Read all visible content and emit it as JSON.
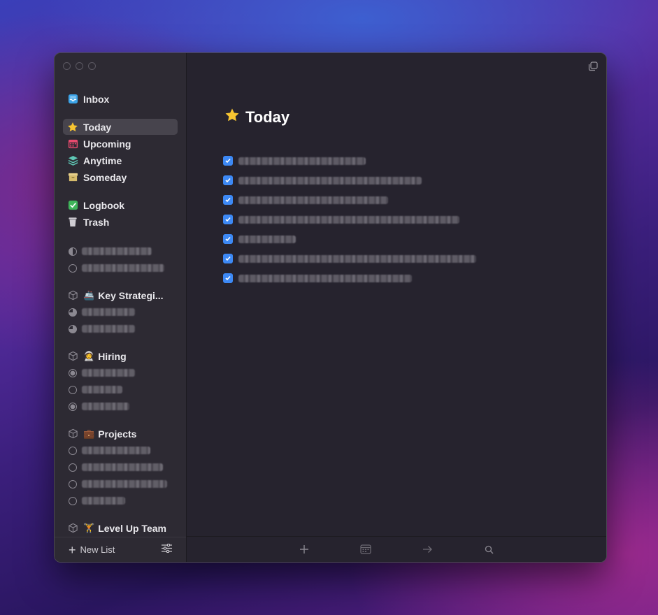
{
  "sidebar": {
    "nav": {
      "inbox": "Inbox",
      "today": "Today",
      "upcoming": "Upcoming",
      "anytime": "Anytime",
      "someday": "Someday",
      "logbook": "Logbook",
      "trash": "Trash"
    },
    "areas": [
      {
        "emoji": "🚢",
        "name": "Key Strategi..."
      },
      {
        "emoji": "👩‍🚀",
        "name": "Hiring"
      },
      {
        "emoji": "💼",
        "name": "Projects"
      },
      {
        "emoji": "🏋️",
        "name": "Level Up Team"
      }
    ],
    "footer": {
      "new_list": "New List"
    }
  },
  "main": {
    "title": "Today",
    "title_icon": "star-icon",
    "task_count": 7
  },
  "toolbar": {
    "icons": [
      "add-icon",
      "calendar-icon",
      "move-arrow-icon",
      "search-icon"
    ]
  },
  "colors": {
    "accent": "#3d89f5",
    "window_bg": "#26232e",
    "sidebar_bg": "#2d2a33"
  }
}
